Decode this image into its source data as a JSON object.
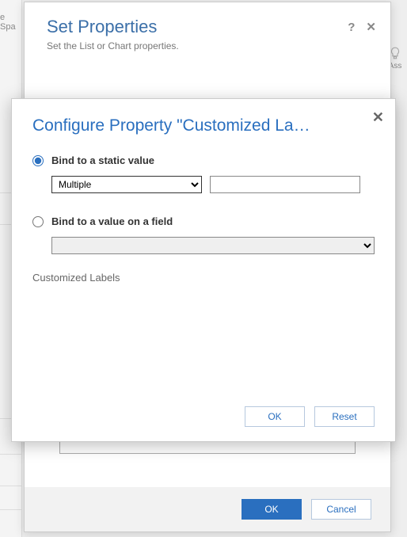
{
  "bg": {
    "left_text": "e Spa",
    "right_icon_label": "Ass"
  },
  "outer": {
    "title": "Set Properties",
    "subtitle": "Set the List or Chart properties.",
    "help_glyph": "?",
    "close_glyph": "✕",
    "ok_label": "OK",
    "cancel_label": "Cancel"
  },
  "inner": {
    "close_glyph": "✕",
    "title": "Configure Property \"Customized La…",
    "option_static_label": "Bind to a static value",
    "option_field_label": "Bind to a value on a field",
    "static_select_value": "Multiple",
    "static_text_value": "",
    "field_select_value": "",
    "property_name": "Customized Labels",
    "ok_label": "OK",
    "reset_label": "Reset",
    "selected_option": "static"
  }
}
